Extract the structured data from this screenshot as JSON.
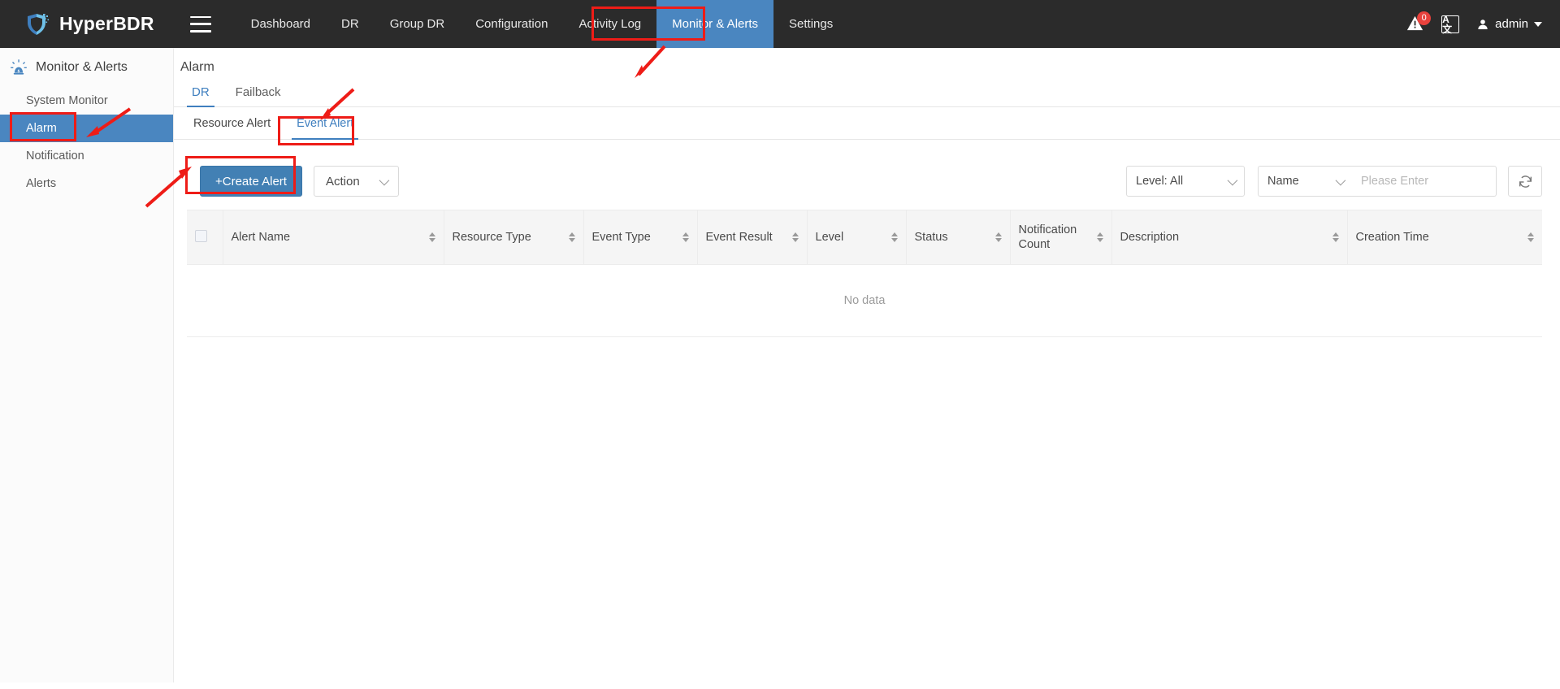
{
  "header": {
    "brand": "HyperBDR",
    "logo_icon": "shield-logo-icon",
    "menu_icon": "hamburger-menu-icon",
    "nav": [
      {
        "label": "Dashboard",
        "active": false
      },
      {
        "label": "DR",
        "active": false
      },
      {
        "label": "Group DR",
        "active": false
      },
      {
        "label": "Configuration",
        "active": false
      },
      {
        "label": "Activity Log",
        "active": false
      },
      {
        "label": "Monitor & Alerts",
        "active": true
      },
      {
        "label": "Settings",
        "active": false
      }
    ],
    "alerts_badge": "0",
    "alerts_icon": "warning-bell-icon",
    "language_icon": "language-translate-icon",
    "language_label": "A文",
    "user_icon": "user-avatar-icon",
    "user_name": "admin"
  },
  "sidebar": {
    "title": "Monitor & Alerts",
    "title_icon": "alarm-siren-icon",
    "items": [
      {
        "label": "System Monitor",
        "active": false
      },
      {
        "label": "Alarm",
        "active": true
      },
      {
        "label": "Notification",
        "active": false
      },
      {
        "label": "Alerts",
        "active": false
      }
    ]
  },
  "main": {
    "page_title": "Alarm",
    "tabs": [
      {
        "label": "DR",
        "active": true
      },
      {
        "label": "Failback",
        "active": false
      }
    ],
    "subtabs": [
      {
        "label": "Resource Alert",
        "active": false
      },
      {
        "label": "Event Alert",
        "active": true
      }
    ],
    "toolbar": {
      "create_label": "+Create Alert",
      "action_label": "Action",
      "action_icon": "chevron-down-icon",
      "level_filter": "Level: All",
      "name_filter": "Name",
      "search_placeholder": "Please Enter",
      "search_value": "",
      "refresh_icon": "refresh-icon"
    },
    "table": {
      "select_all_checkbox": "",
      "columns": [
        {
          "label": "Alert Name",
          "sortable": true
        },
        {
          "label": "Resource Type",
          "sortable": true
        },
        {
          "label": "Event Type",
          "sortable": true
        },
        {
          "label": "Event Result",
          "sortable": true
        },
        {
          "label": "Level",
          "sortable": true
        },
        {
          "label": "Status",
          "sortable": true
        },
        {
          "label": "Notification Count",
          "sortable": true
        },
        {
          "label": "Description",
          "sortable": true
        },
        {
          "label": "Creation Time",
          "sortable": true
        }
      ],
      "rows": [],
      "empty_text": "No data"
    }
  },
  "annotations": {
    "color": "#ee1c17",
    "boxes": [
      "monitor-alerts-nav",
      "sidebar-alarm-item",
      "event-alert-subtab",
      "create-alert-button"
    ],
    "arrows": [
      "arrow-to-monitor-alerts",
      "arrow-to-event-alert",
      "arrow-to-sidebar-alarm",
      "arrow-to-create-alert"
    ]
  }
}
